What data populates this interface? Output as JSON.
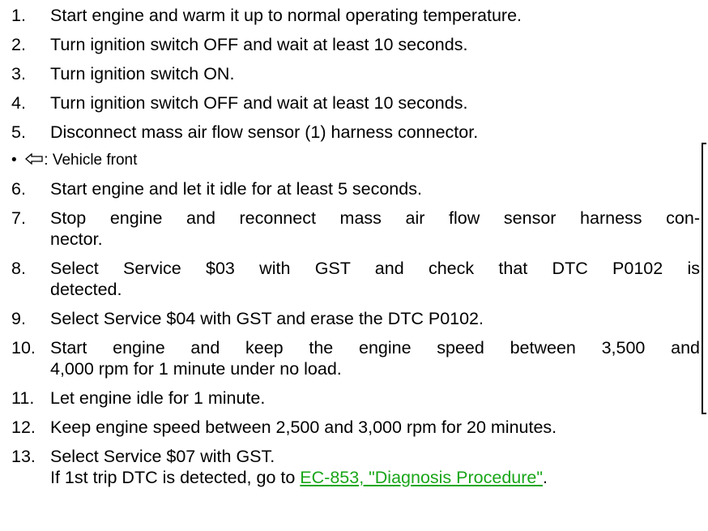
{
  "steps": [
    {
      "num": "1.",
      "lines": [
        "Start engine and warm it up to normal operating temperature."
      ]
    },
    {
      "num": "2.",
      "lines": [
        "Turn ignition switch OFF and wait at least 10 seconds."
      ]
    },
    {
      "num": "3.",
      "lines": [
        "Turn ignition switch ON."
      ]
    },
    {
      "num": "4.",
      "lines": [
        "Turn ignition switch OFF and wait at least 10 seconds."
      ]
    },
    {
      "num": "5.",
      "lines": [
        "Disconnect mass air flow sensor (1) harness connector."
      ]
    },
    {
      "num": "6.",
      "lines": [
        "Start engine and let it idle for at least 5 seconds."
      ]
    },
    {
      "num": "7.",
      "lines": [
        "Stop engine and reconnect mass air flow sensor harness con-",
        "nector."
      ]
    },
    {
      "num": "8.",
      "lines": [
        "Select Service $03 with GST and check that DTC P0102 is",
        "detected."
      ]
    },
    {
      "num": "9.",
      "lines": [
        "Select Service $04 with GST and erase the DTC P0102."
      ]
    },
    {
      "num": "10.",
      "lines": [
        "Start engine and keep the engine speed between 3,500 and",
        "4,000 rpm for 1 minute under no load."
      ]
    },
    {
      "num": "11.",
      "lines": [
        "Let engine idle for 1 minute."
      ]
    },
    {
      "num": "12.",
      "lines": [
        "Keep engine speed between 2,500 and 3,000 rpm for 20 minutes."
      ]
    },
    {
      "num": "13.",
      "lines": [
        "Select Service $07 with GST.",
        "If 1st trip DTC is detected, go to "
      ]
    }
  ],
  "bullet": {
    "dot": "•",
    "icon": "hollow-left-arrow-icon",
    "text": ": Vehicle front"
  },
  "link": {
    "text": "EC-853, \"Diagnosis Procedure\"",
    "trailing": ".",
    "color": "#19a619"
  }
}
